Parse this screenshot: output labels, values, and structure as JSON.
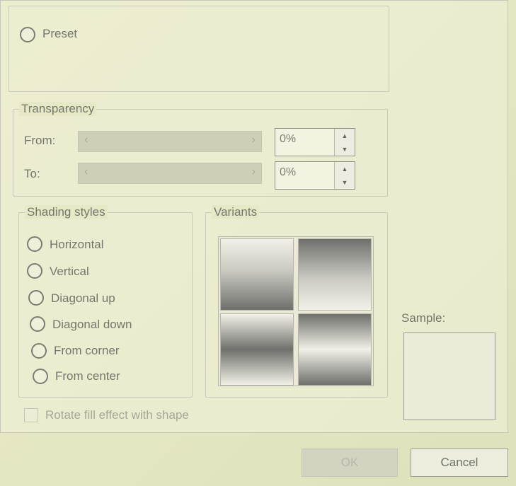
{
  "top_group": {
    "preset_label": "Preset"
  },
  "transparency": {
    "legend": "Transparency",
    "from_label": "From:",
    "from_value": "0%",
    "to_label": "To:",
    "to_value": "0%"
  },
  "shading_styles": {
    "legend": "Shading styles",
    "options": [
      "Horizontal",
      "Vertical",
      "Diagonal up",
      "Diagonal down",
      "From corner",
      "From center"
    ]
  },
  "variants": {
    "legend": "Variants"
  },
  "sample": {
    "label": "Sample:"
  },
  "rotate_checkbox": {
    "label": "Rotate fill effect with shape"
  },
  "buttons": {
    "ok": "OK",
    "cancel": "Cancel"
  },
  "icons": {
    "slider_left": "chevron-left-icon",
    "slider_right": "chevron-right-icon",
    "spin_up": "spin-up-icon",
    "spin_down": "spin-down-icon"
  },
  "colors": {
    "screen_tint": "#e7e8c6",
    "text": "#74776b",
    "variant_dark": "#6f706c",
    "variant_light": "#f1f1e8"
  }
}
